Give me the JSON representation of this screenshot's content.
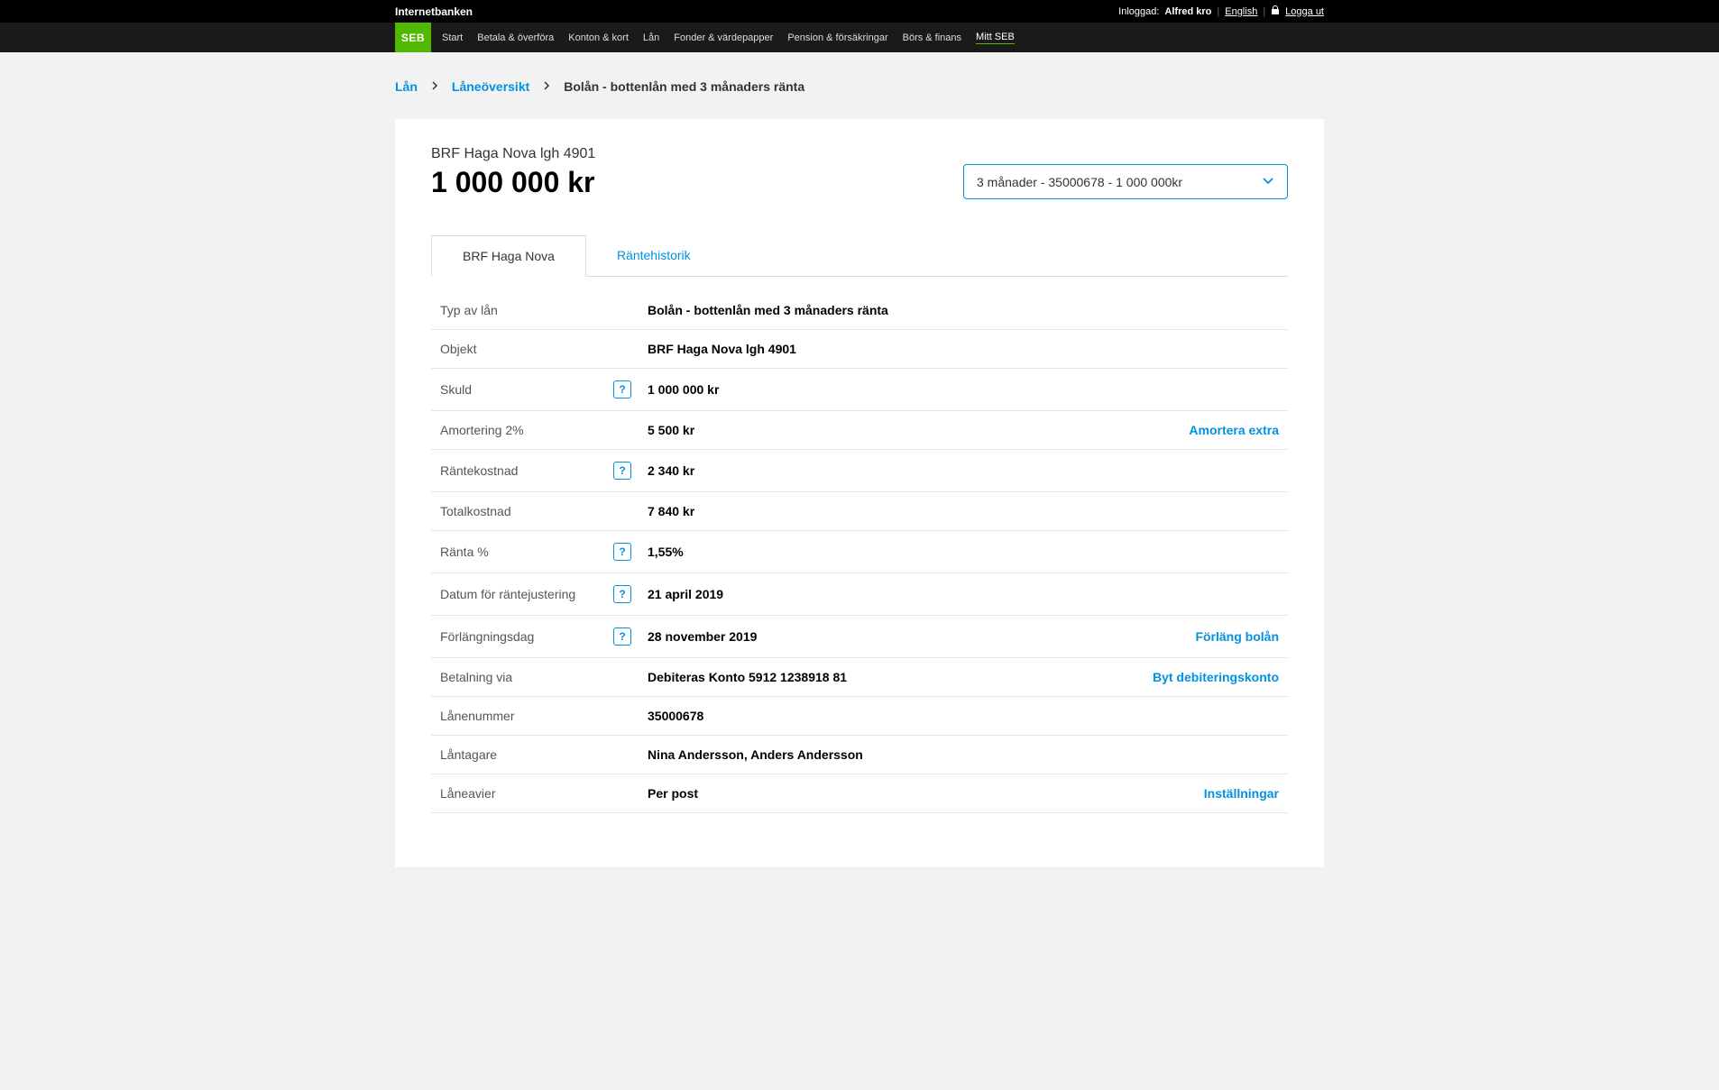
{
  "topbar": {
    "brand": "Internetbanken",
    "logged_in_label": "Inloggad:",
    "user": "Alfred kro",
    "language": "English",
    "logout": "Logga ut"
  },
  "logo": "SEB",
  "nav": {
    "start": "Start",
    "pay": "Betala & överföra",
    "accounts": "Konton & kort",
    "loan": "Lån",
    "funds": "Fonder & värdepapper",
    "pension": "Pension & försäkringar",
    "market": "Börs & finans",
    "myseb": "Mitt SEB"
  },
  "breadcrumb": {
    "b1": "Lån",
    "b2": "Låneöversikt",
    "current": "Bolån - bottenlån med 3 månaders ränta"
  },
  "header": {
    "title": "BRF Haga Nova lgh 4901",
    "amount": "1 000 000 kr",
    "select_value": "3 månader - 35000678 - 1 000 000kr"
  },
  "tabs": {
    "tab1": "BRF Haga Nova",
    "tab2": "Räntehistorik"
  },
  "rows": {
    "type_label": "Typ av lån",
    "type_value": "Bolån - bottenlån med 3 månaders ränta",
    "object_label": "Objekt",
    "object_value": "BRF Haga Nova lgh 4901",
    "debt_label": "Skuld",
    "debt_value": "1 000 000 kr",
    "amort_label": "Amortering 2%",
    "amort_value": "5 500 kr",
    "amort_action": "Amortera extra",
    "intcost_label": "Räntekostnad",
    "intcost_value": "2 340 kr",
    "total_label": "Totalkostnad",
    "total_value": "7 840 kr",
    "rate_label": "Ränta %",
    "rate_value": "1,55%",
    "adjust_label": "Datum för räntejustering",
    "adjust_value": "21 april 2019",
    "extend_label": "Förlängningsdag",
    "extend_value": "28 november 2019",
    "extend_action": "Förläng bolån",
    "pay_label": "Betalning via",
    "pay_value": "Debiteras Konto 5912 1238918 81",
    "pay_action": "Byt debiteringskonto",
    "loannum_label": "Lånenummer",
    "loannum_value": "35000678",
    "borrower_label": "Låntagare",
    "borrower_value": "Nina Andersson, Anders Andersson",
    "notice_label": "Låneavier",
    "notice_value": "Per post",
    "notice_action": "Inställningar"
  },
  "help": "?"
}
